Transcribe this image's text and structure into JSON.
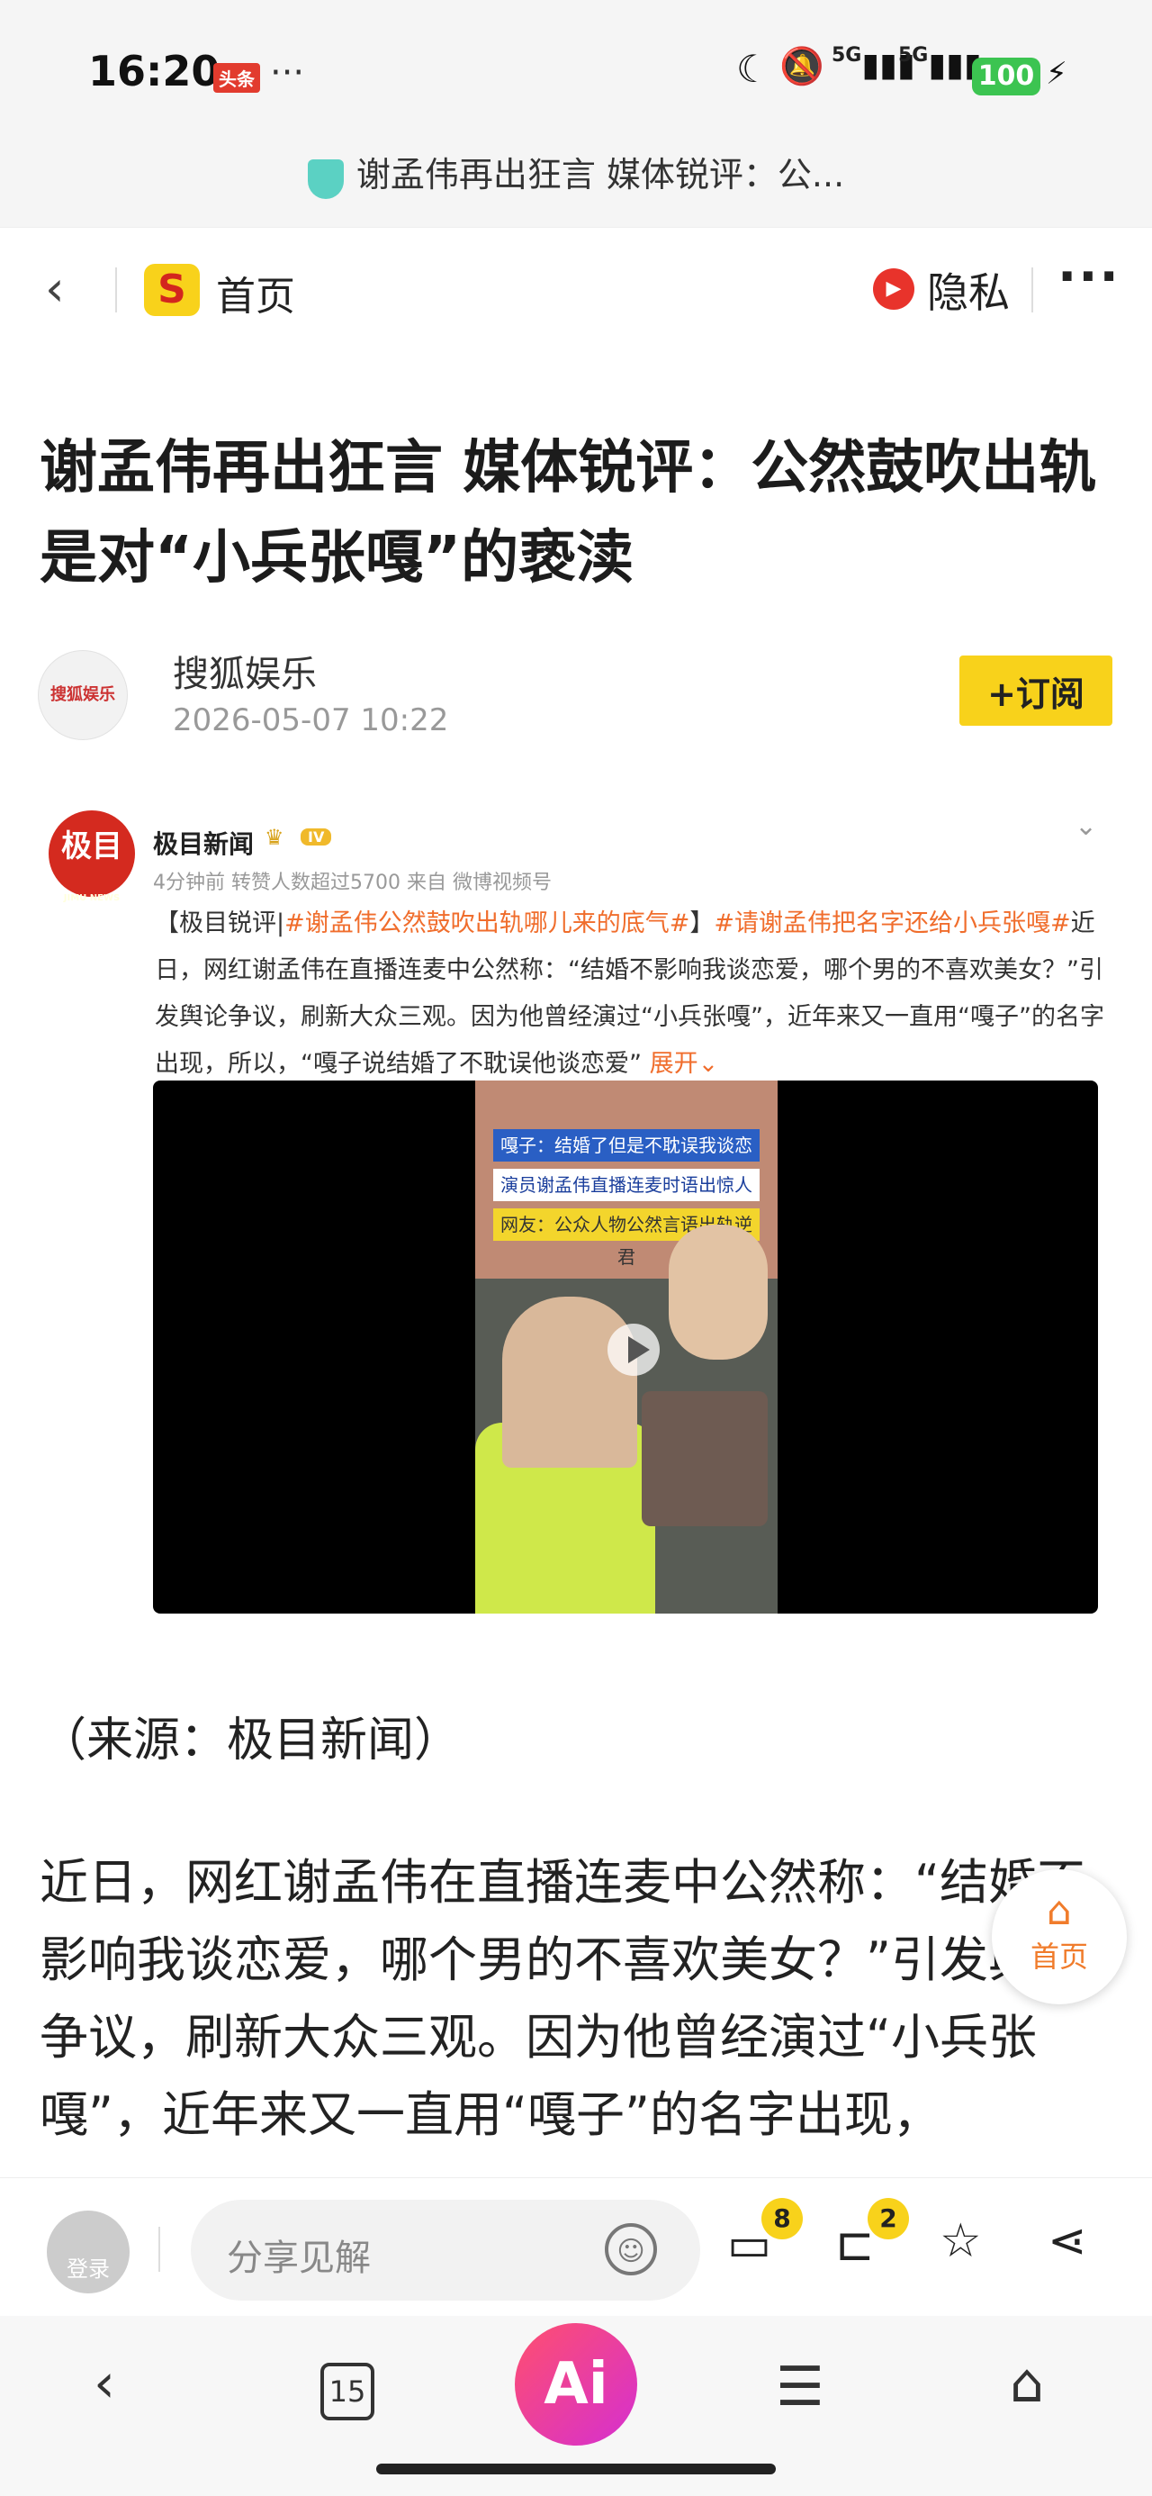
{
  "status_bar": {
    "time": "16:20",
    "app_badge": "头条",
    "more": "···",
    "signal_1": "5G",
    "signal_2": "5G",
    "battery": "100"
  },
  "url_bar": {
    "title": "谢孟伟再出狂言 媒体锐评：公..."
  },
  "nav": {
    "home_label": "首页",
    "privacy_label": "隐私",
    "more": "···"
  },
  "article": {
    "title": "谢孟伟再出狂言 媒体锐评：公然鼓吹出轨是对“小兵张嘎”的亵渎",
    "author": "搜狐娱乐",
    "author_logo_text": "搜狐娱乐",
    "publish_time": "2026-05-07 10:22",
    "subscribe_label": "+订阅",
    "source": "（来源：极目新闻）",
    "paragraph": "近日，网红谢孟伟在直播连麦中公然称：“结婚不影响我谈恋爱，哪个男的不喜欢美女？”引发舆论争议，刷新大众三观。因为他曾经演过“小兵张嘎”，近年来又一直用“嘎子”的名字出现，"
  },
  "embedded_post": {
    "logo_text": "极目",
    "logo_sub": "JIMU NEWS",
    "account": "极目新闻",
    "level": "IV",
    "meta": "4分钟前 转赞人数超过5700 来自 微博视频号",
    "prefix": "【极目锐评|",
    "hashtag_1": "#谢孟伟公然鼓吹出轨哪儿来的底气#",
    "middle": "】",
    "hashtag_2": "#请谢孟伟把名字还给小兵张嘎#",
    "body": "近日，网红谢孟伟在直播连麦中公然称：“结婚不影响我谈恋爱，哪个男的不喜欢美女？”引发舆论争议，刷新大众三观。因为他曾经演过“小兵张嘎”，近年来又一直用“嘎子”的名字出现，所以，“嘎子说结婚了不耽误他谈恋爱”",
    "expand": "展开",
    "video_caption_1": "嘎子：结婚了但是不耽误我谈恋爱",
    "video_caption_2": "演员谢孟伟直播连麦时语出惊人",
    "video_caption_3": "网友：公众人物公然言语出轨逆君"
  },
  "floating_home": {
    "label": "首页"
  },
  "comment_bar": {
    "login_label": "登录",
    "placeholder": "分享见解",
    "comment_count": "8",
    "collect_count": "2"
  },
  "bottom_nav": {
    "tab_count": "15",
    "ai_label": "Ai"
  },
  "colors": {
    "accent_yellow": "#f8d21b",
    "brand_red": "#d42a1f",
    "hashtag_orange": "#f06d2c",
    "ai_gradient_start": "#ff4f6e"
  }
}
